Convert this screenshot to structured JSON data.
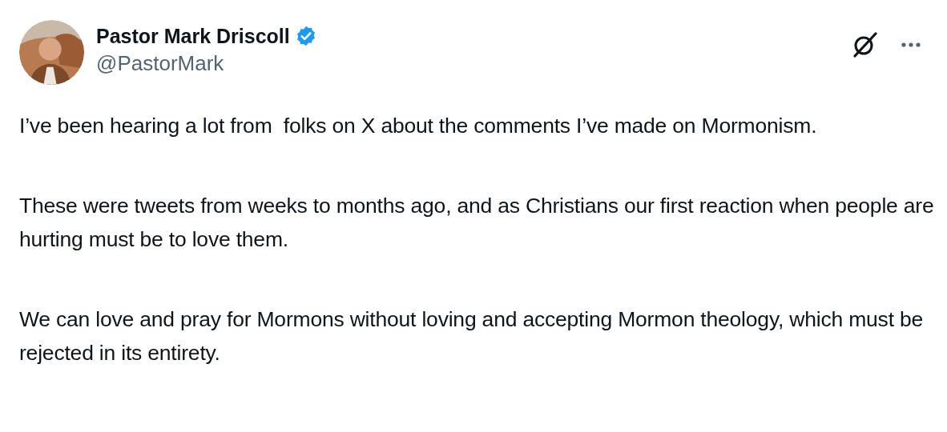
{
  "author": {
    "name": "Pastor Mark Driscoll",
    "verified": true,
    "handle": "@PastorMark"
  },
  "paragraphs": [
    "I’ve been hearing a lot from  folks on X about the comments I’ve made on Mormonism.",
    "These were tweets from weeks to months ago, and as Christians our first reaction when people are hurting must be to love them.",
    "We can love and pray for Mormons without loving and accepting Mormon theology, which must be rejected in its entirety."
  ]
}
